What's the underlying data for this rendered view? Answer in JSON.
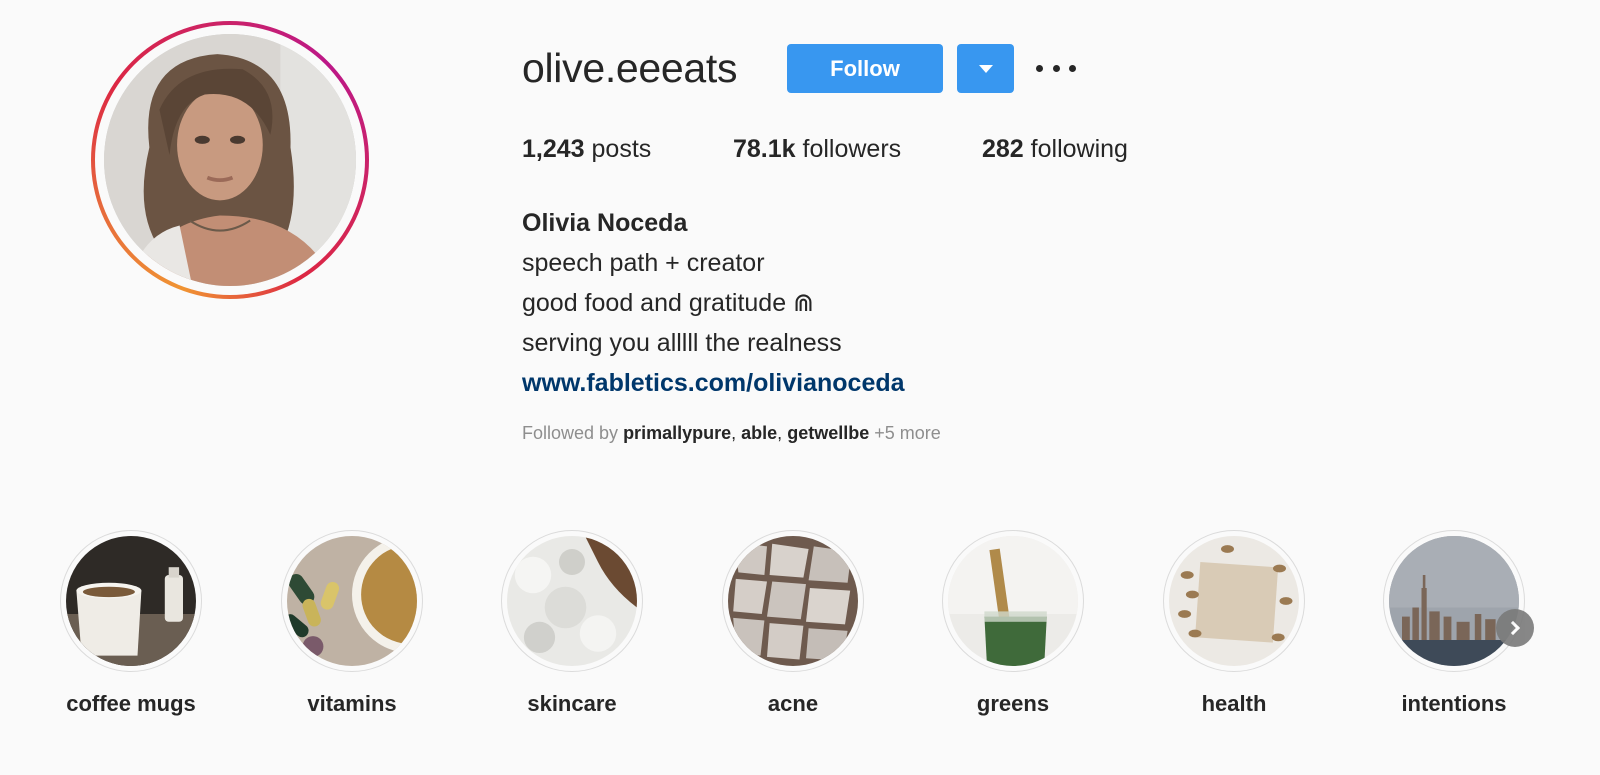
{
  "profile": {
    "username": "olive.eeeats",
    "follow_label": "Follow",
    "stats": {
      "posts_count": "1,243",
      "posts_label": "posts",
      "followers_count": "78.1k",
      "followers_label": "followers",
      "following_count": "282",
      "following_label": "following"
    },
    "bio": {
      "full_name": "Olivia Noceda",
      "line1": "speech path + creator",
      "line2": "good food and gratitude ⋒",
      "line3": "serving you alllll the realness",
      "link": "www.fabletics.com/olivianoceda"
    },
    "followed_by": {
      "prefix": "Followed by",
      "accounts": [
        "primallypure",
        "able",
        "getwellbe"
      ],
      "more": "+5 more"
    }
  },
  "highlights": [
    {
      "label": "coffee mugs"
    },
    {
      "label": "vitamins"
    },
    {
      "label": "skincare"
    },
    {
      "label": "acne"
    },
    {
      "label": "greens"
    },
    {
      "label": "health"
    },
    {
      "label": "intentions"
    }
  ],
  "colors": {
    "accent": "#3897f0",
    "link": "#00376b",
    "text": "#262626",
    "muted": "#8e8e8e",
    "background": "#fafafa"
  },
  "icons": {
    "dropdown": "caret-down-icon",
    "more": "more-horizontal-icon",
    "next": "chevron-right-icon"
  }
}
